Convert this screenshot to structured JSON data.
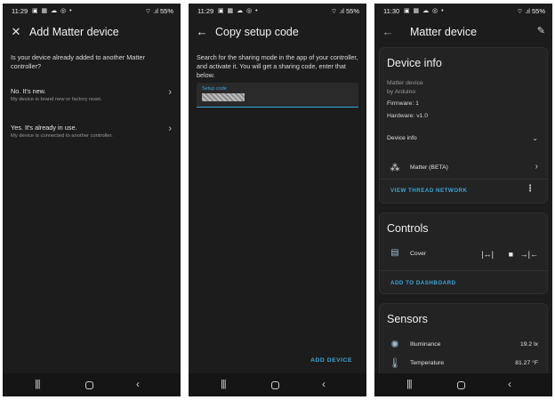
{
  "panel1": {
    "status": {
      "time": "11:29",
      "icons": "▣ ▦ ☁ ◎ •",
      "right": "⌔ .ıl 55%"
    },
    "title": "Add Matter device",
    "question": "Is your device already added to another Matter controller?",
    "options": [
      {
        "title": "No. It's new.",
        "subtitle": "My device is brand new or factory reset."
      },
      {
        "title": "Yes. It's already in use.",
        "subtitle": "My device is connected to another controller."
      }
    ]
  },
  "panel2": {
    "status": {
      "time": "11:29",
      "icons": "▣ ▦ ☁ ◎ •",
      "right": "⌔ .ıl 55%"
    },
    "title": "Copy setup code",
    "instructions": "Search for the sharing mode in the app of your controller, and activate it. You will get a sharing code, enter that below.",
    "field_label": "Setup code",
    "add_button": "ADD DEVICE"
  },
  "panel3": {
    "status": {
      "time": "11:30",
      "icons": "▣ ▦ ☁ ◎ •",
      "right": "⌔ .ıl 55%"
    },
    "title": "Matter device",
    "device_info": {
      "heading": "Device info",
      "name": "Matter device",
      "manufacturer": "by Arduino",
      "firmware": "Firmware: 1",
      "hardware": "Hardware: v1.0",
      "expand_label": "Device info",
      "integration": "Matter (BETA)",
      "thread_link": "VIEW THREAD NETWORK"
    },
    "controls": {
      "heading": "Controls",
      "entity": "Cover",
      "add_link": "ADD TO DASHBOARD"
    },
    "sensors": {
      "heading": "Sensors",
      "items": [
        {
          "label": "Illuminance",
          "value": "19.2 lx"
        },
        {
          "label": "Temperature",
          "value": "81.27 °F"
        }
      ]
    }
  },
  "colors": {
    "background": "#1c1c1c",
    "accent": "#3aa7d8",
    "card": "#232323"
  }
}
